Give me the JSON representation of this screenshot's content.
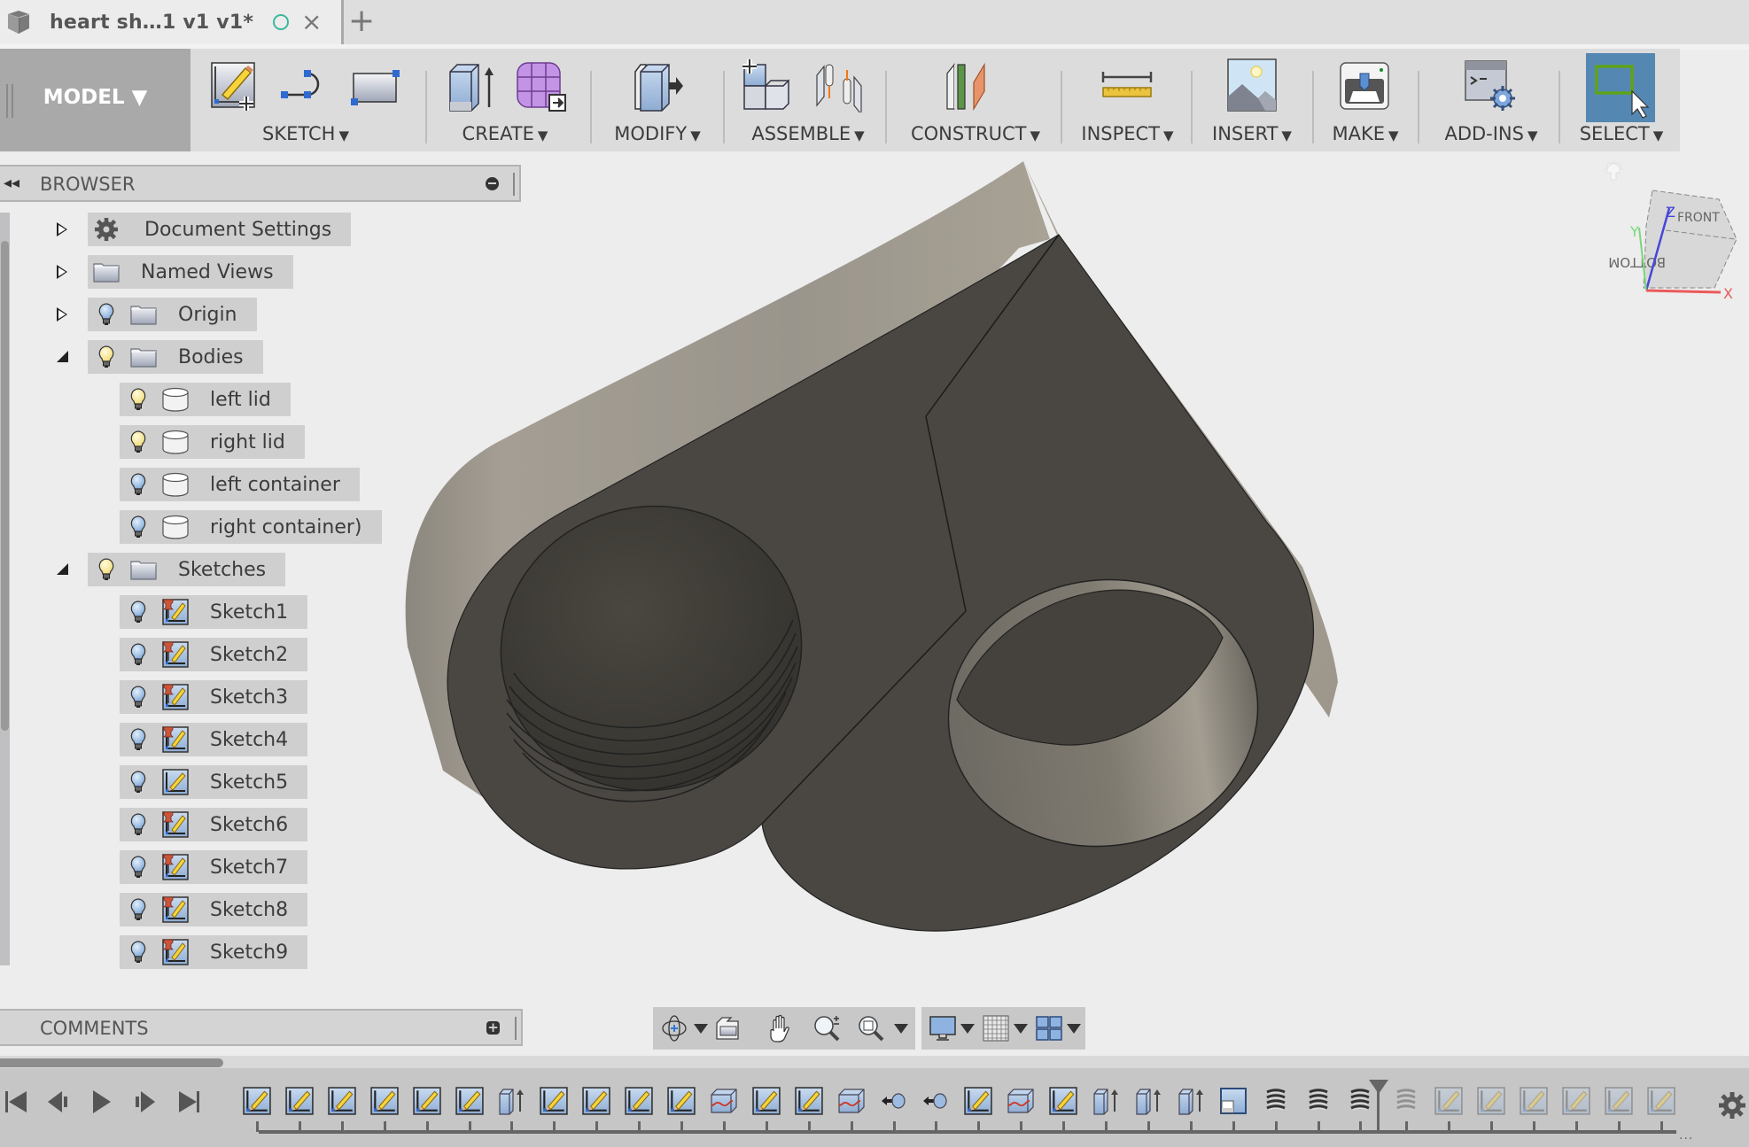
{
  "tab": {
    "title": "heart sh…1 v1 v1*",
    "status_icon": "saved-status-circle",
    "close_label": "×",
    "new_tab_label": "+"
  },
  "toolbar": {
    "workspace": "MODEL ▼",
    "groups": [
      {
        "label": "SKETCH",
        "icons": [
          "create-sketch-icon",
          "arc-line-icon",
          "rectangle-icon"
        ]
      },
      {
        "label": "CREATE",
        "icons": [
          "extrude-icon",
          "tspline-form-icon"
        ]
      },
      {
        "label": "MODIFY",
        "icons": [
          "press-pull-icon"
        ]
      },
      {
        "label": "ASSEMBLE",
        "icons": [
          "new-component-icon",
          "joint-icon"
        ]
      },
      {
        "label": "CONSTRUCT",
        "icons": [
          "offset-plane-icon"
        ]
      },
      {
        "label": "INSPECT",
        "icons": [
          "measure-icon"
        ]
      },
      {
        "label": "INSERT",
        "icons": [
          "insert-image-icon"
        ]
      },
      {
        "label": "MAKE",
        "icons": [
          "3d-print-icon"
        ]
      },
      {
        "label": "ADD-INS",
        "icons": [
          "scripts-addins-icon"
        ]
      },
      {
        "label": "SELECT",
        "icons": [
          "window-select-icon"
        ]
      }
    ],
    "dropdown_glyph": "▼"
  },
  "browser": {
    "title": "BROWSER",
    "collapse_glyph": "◂◂",
    "items": [
      {
        "label": "Document Settings",
        "icon": "gear-icon",
        "expander": "closed",
        "bulb": null
      },
      {
        "label": "Named Views",
        "icon": "folder-icon",
        "expander": "closed",
        "bulb": null
      },
      {
        "label": "Origin",
        "icon": "folder-icon",
        "expander": "closed",
        "bulb": "hidden"
      },
      {
        "label": "Bodies",
        "icon": "folder-icon",
        "expander": "open",
        "bulb": "visible"
      },
      {
        "label": "left lid",
        "icon": "body-icon",
        "bulb": "visible",
        "child": true
      },
      {
        "label": "right lid",
        "icon": "body-icon",
        "bulb": "visible",
        "child": true
      },
      {
        "label": "left container",
        "icon": "body-icon",
        "bulb": "hidden",
        "child": true
      },
      {
        "label": "right container)",
        "icon": "body-icon",
        "bulb": "hidden",
        "child": true
      },
      {
        "label": "Sketches",
        "icon": "folder-icon",
        "expander": "open",
        "bulb": "visible"
      },
      {
        "label": "Sketch1",
        "icon": "sketch-pinned-icon",
        "bulb": "hidden",
        "child": true
      },
      {
        "label": "Sketch2",
        "icon": "sketch-pinned-icon",
        "bulb": "hidden",
        "child": true
      },
      {
        "label": "Sketch3",
        "icon": "sketch-pinned-icon",
        "bulb": "hidden",
        "child": true
      },
      {
        "label": "Sketch4",
        "icon": "sketch-pinned-icon",
        "bulb": "hidden",
        "child": true
      },
      {
        "label": "Sketch5",
        "icon": "sketch-icon",
        "bulb": "hidden",
        "child": true
      },
      {
        "label": "Sketch6",
        "icon": "sketch-pinned-icon",
        "bulb": "hidden",
        "child": true
      },
      {
        "label": "Sketch7",
        "icon": "sketch-pinned-icon",
        "bulb": "hidden",
        "child": true
      },
      {
        "label": "Sketch8",
        "icon": "sketch-pinned-icon",
        "bulb": "hidden",
        "child": true
      },
      {
        "label": "Sketch9",
        "icon": "sketch-pinned-icon",
        "bulb": "hidden",
        "child": true
      }
    ]
  },
  "comments": {
    "title": "COMMENTS",
    "add_glyph": "+"
  },
  "viewcube": {
    "faces": [
      "FRONT",
      "BOTTOM"
    ],
    "axes": [
      "X",
      "Y",
      "Z"
    ]
  },
  "nav_toolbar": {
    "tools": [
      "orbit-icon",
      "look-at-icon",
      "pan-icon",
      "zoom-icon",
      "fit-window-icon"
    ],
    "display": [
      "display-settings-icon",
      "grid-settings-icon",
      "viewports-icon"
    ]
  },
  "timeline": {
    "playback": [
      "go-to-start",
      "step-back",
      "play",
      "step-forward",
      "go-to-end"
    ],
    "features": [
      "sketch",
      "sketch",
      "sketch",
      "sketch",
      "sketch",
      "sketch",
      "extrude",
      "sketch",
      "sketch",
      "sketch",
      "sketch",
      "split-body",
      "sketch",
      "sketch",
      "split-body",
      "joint",
      "joint",
      "sketch",
      "split-body",
      "sketch",
      "extrude",
      "extrude",
      "extrude",
      "split-face",
      "thread",
      "thread",
      "thread",
      "thread",
      "sketch",
      "sketch",
      "sketch",
      "sketch",
      "sketch",
      "sketch"
    ],
    "marker_after_index": 26,
    "more_glyph": "..."
  },
  "colors": {
    "select_active": "#5587b3",
    "toolbar_bg": "#dcdcdc",
    "model_btn": "#a9a9a9",
    "body_dark": "#4a4742",
    "body_side": "#a19b91",
    "saved_status": "#3cb89b"
  }
}
